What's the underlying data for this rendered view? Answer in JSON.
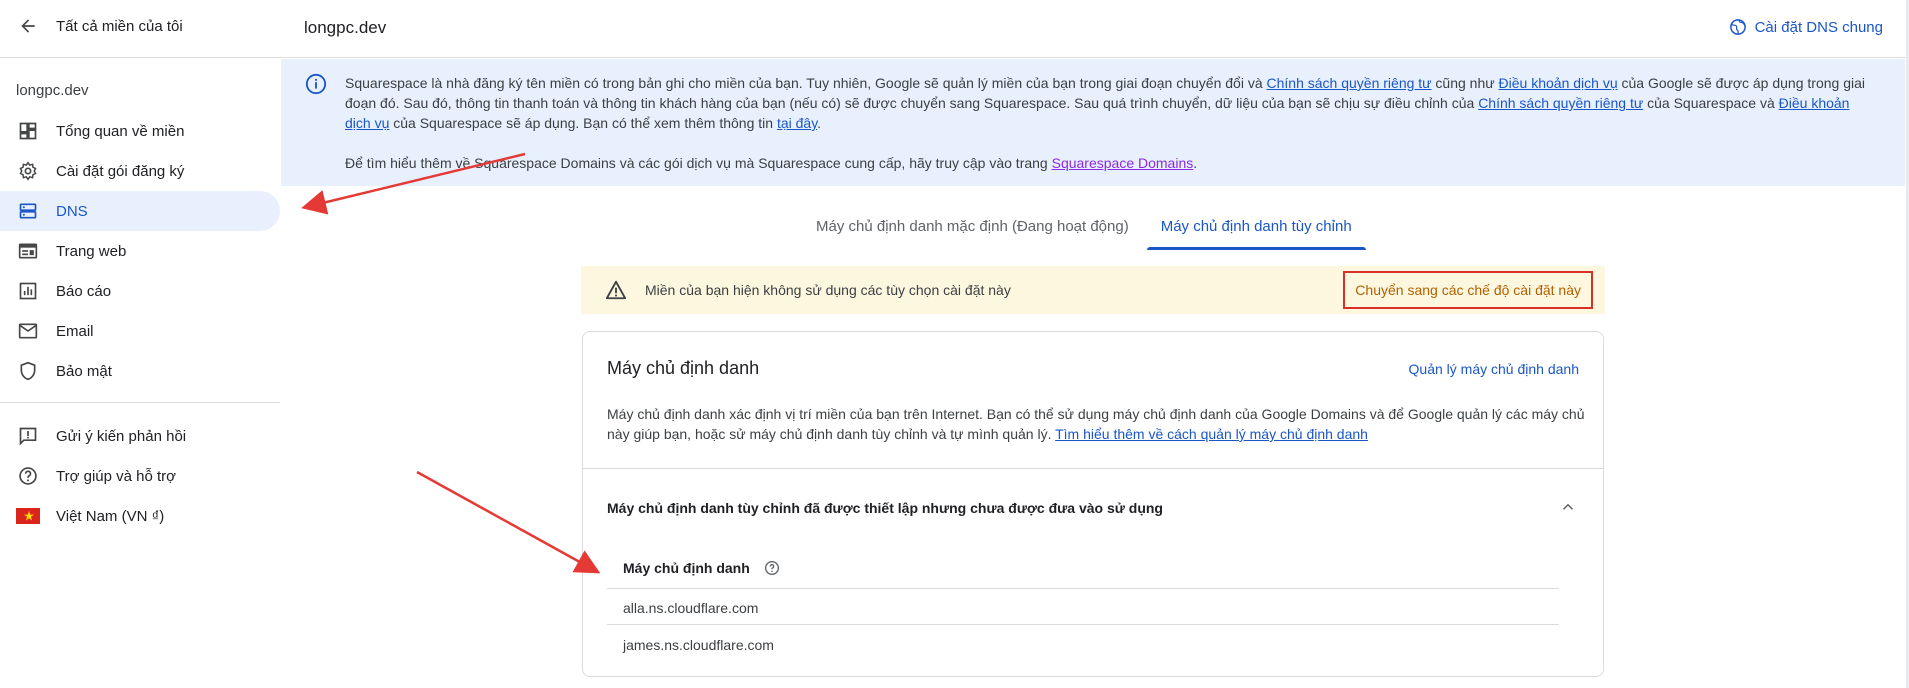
{
  "sidebar": {
    "back_label": "Tất cả miền của tôi",
    "domain": "longpc.dev",
    "items": [
      {
        "label": "Tổng quan về miền",
        "icon": "dashboard-icon"
      },
      {
        "label": "Cài đặt gói đăng ký",
        "icon": "gear-icon"
      },
      {
        "label": "DNS",
        "icon": "dns-icon",
        "active": true
      },
      {
        "label": "Trang web",
        "icon": "web-icon"
      },
      {
        "label": "Báo cáo",
        "icon": "bar-chart-icon"
      },
      {
        "label": "Email",
        "icon": "mail-icon"
      },
      {
        "label": "Bảo mật",
        "icon": "shield-icon"
      }
    ],
    "footer_items": [
      {
        "label": "Gửi ý kiến phản hồi",
        "icon": "feedback-icon"
      },
      {
        "label": "Trợ giúp và hỗ trợ",
        "icon": "help-icon"
      },
      {
        "label": "Việt Nam (VN ₫)",
        "icon": "vietnam-flag-icon"
      }
    ]
  },
  "header": {
    "title": "longpc.dev",
    "dns_general": "Cài đặt DNS chung"
  },
  "banner": {
    "p1_a": "Squarespace là nhà đăng ký tên miền có trong bản ghi cho miền của bạn. Tuy nhiên, Google sẽ quản lý miền của bạn trong giai đoạn chuyển đổi và ",
    "p1_link1": "Chính sách quyền riêng tư",
    "p1_b": " cũng như ",
    "p1_link2": "Điều khoản dịch vụ",
    "p1_c": " của Google sẽ được áp dụng trong giai đoạn đó. Sau đó, thông tin thanh toán và thông tin khách hàng của bạn (nếu có) sẽ được chuyển sang Squarespace. Sau quá trình chuyển, dữ liệu của bạn sẽ chịu sự điều chỉnh của ",
    "p1_link3": "Chính sách quyền riêng tư",
    "p1_d": " của Squarespace và ",
    "p1_link4": "Điều khoản dịch vụ",
    "p1_e": " của Squarespace sẽ áp dụng. Bạn có thể xem thêm thông tin ",
    "p1_link5": "tại đây",
    "p1_f": ".",
    "p2_a": "Để tìm hiểu thêm về Squarespace Domains và các gói dịch vụ mà Squarespace cung cấp, hãy truy cập vào trang ",
    "p2_link": "Squarespace Domains",
    "p2_b": "."
  },
  "tabs": [
    {
      "label": "Máy chủ định danh mặc định (Đang hoạt động)",
      "active": false
    },
    {
      "label": "Máy chủ định danh tùy chỉnh",
      "active": true
    }
  ],
  "warning": {
    "text": "Miền của bạn hiện không sử dụng các tùy chọn cài đặt này",
    "button": "Chuyển sang các chế độ cài đặt này"
  },
  "card": {
    "title": "Máy chủ định danh",
    "manage_link": "Quản lý máy chủ định danh",
    "desc_a": "Máy chủ định danh xác định vị trí miền của bạn trên Internet. Bạn có thể sử dụng máy chủ định danh của Google Domains và để Google quản lý các máy chủ này giúp bạn, hoặc sử máy chủ định danh tùy chỉnh và tự mình quản lý. ",
    "desc_link": "Tìm hiểu thêm về cách quản lý máy chủ định danh",
    "section_title": "Máy chủ định danh tùy chỉnh đã được thiết lập nhưng chưa được đưa vào sử dụng",
    "column_header": "Máy chủ định danh",
    "nameservers": [
      "alla.ns.cloudflare.com",
      "james.ns.cloudflare.com"
    ]
  },
  "colors": {
    "accent": "#1a56c8",
    "banner_bg": "#e8f0fe",
    "warning_bg": "#fef7e0",
    "annotation_red": "#e53935"
  }
}
